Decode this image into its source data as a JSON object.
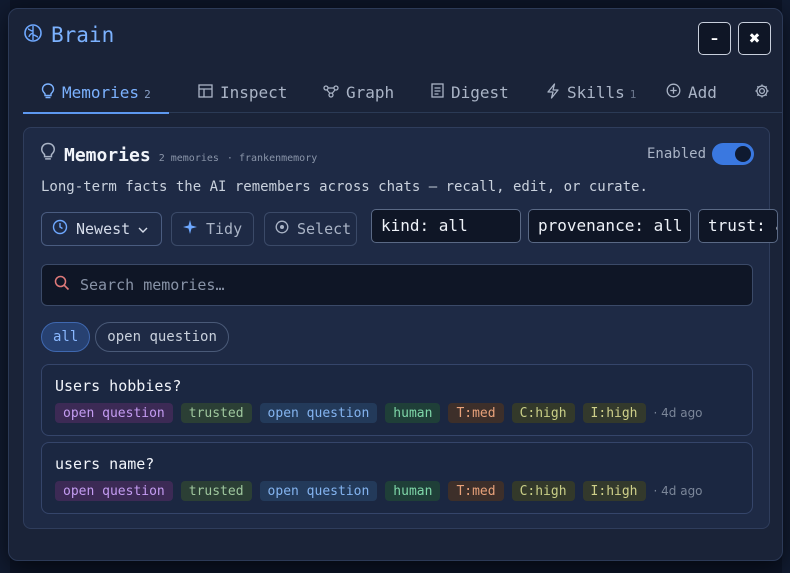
{
  "app": {
    "title": "Brain",
    "minimize_label": "–",
    "close_label": "✖"
  },
  "tabs": [
    {
      "label": "Memories",
      "count": "2",
      "icon": "lightbulb-icon"
    },
    {
      "label": "Inspect",
      "count": "",
      "icon": "table-icon"
    },
    {
      "label": "Graph",
      "count": "",
      "icon": "graph-icon"
    },
    {
      "label": "Digest",
      "count": "",
      "icon": "document-icon"
    },
    {
      "label": "Skills",
      "count": "1",
      "icon": "bolt-icon"
    },
    {
      "label": "Add",
      "count": "",
      "icon": "plus-circle-icon"
    },
    {
      "label": "",
      "count": "",
      "icon": "gear-icon"
    }
  ],
  "memories_panel": {
    "title": "Memories",
    "count_text": "2 memories",
    "source_text": "· frankenmemory",
    "enabled_label": "Enabled",
    "enabled": true,
    "description": "Long-term facts the AI remembers across chats — recall, edit, or curate.",
    "sort_label": "Newest",
    "tidy_label": "Tidy",
    "select_label": "Select",
    "filters": {
      "kind": "kind: all",
      "provenance": "provenance: all",
      "trust": "trust: all"
    },
    "search_placeholder": "Search memories…",
    "chips": [
      "all",
      "open question"
    ],
    "items": [
      {
        "title": "Users hobbies?",
        "tags": [
          "open question",
          "trusted",
          "open question",
          "human",
          "T:med",
          "C:high",
          "I:high"
        ],
        "age": "· 4d ago"
      },
      {
        "title": "users name?",
        "tags": [
          "open question",
          "trusted",
          "open question",
          "human",
          "T:med",
          "C:high",
          "I:high"
        ],
        "age": "· 4d ago"
      }
    ]
  },
  "colors": {
    "accent": "#7cb2ff",
    "panel_bg": "#1a2338",
    "toggle_on": "#3a78e0"
  }
}
